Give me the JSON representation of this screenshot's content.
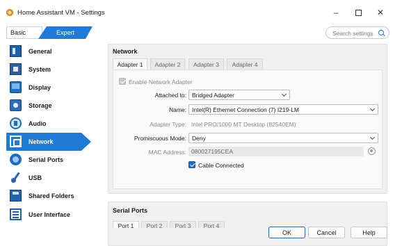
{
  "window": {
    "title": "Home Assistant VM - Settings",
    "minimize": "–",
    "close": "✕"
  },
  "mode": {
    "basic": "Basic",
    "expert": "Expert"
  },
  "search": {
    "placeholder": "Search settings"
  },
  "sidebar": {
    "items": [
      {
        "label": "General",
        "icon": "general-icon"
      },
      {
        "label": "System",
        "icon": "system-icon"
      },
      {
        "label": "Display",
        "icon": "display-icon"
      },
      {
        "label": "Storage",
        "icon": "storage-icon"
      },
      {
        "label": "Audio",
        "icon": "audio-icon"
      },
      {
        "label": "Network",
        "icon": "network-icon",
        "active": true
      },
      {
        "label": "Serial Ports",
        "icon": "serial-ports-icon"
      },
      {
        "label": "USB",
        "icon": "usb-icon"
      },
      {
        "label": "Shared Folders",
        "icon": "shared-folders-icon"
      },
      {
        "label": "User Interface",
        "icon": "user-interface-icon"
      }
    ]
  },
  "network": {
    "title": "Network",
    "tabs": [
      "Adapter 1",
      "Adapter 2",
      "Adapter 3",
      "Adapter 4"
    ],
    "active_tab": "Adapter 1",
    "enable_adapter": {
      "label": "Enable Network Adapter",
      "checked": true,
      "enabled": false
    },
    "attached_to": {
      "label": "Attached to:",
      "value": "Bridged Adapter"
    },
    "name": {
      "label": "Name:",
      "value": "Intel(R) Ethernet Connection (7) I219-LM"
    },
    "adapter_type": {
      "label": "Adapter Type:",
      "value": "Intel PRO/1000 MT Desktop (82540EM)"
    },
    "promiscuous_mode": {
      "label": "Promiscuous Mode:",
      "value": "Deny"
    },
    "mac_address": {
      "label": "MAC Address:",
      "value": "080027195CEA"
    },
    "cable_connected": {
      "label": "Cable Connected",
      "checked": true
    }
  },
  "serial_ports": {
    "title": "Serial Ports",
    "tabs": [
      "Port 1",
      "Port 2",
      "Port 3",
      "Port 4"
    ]
  },
  "buttons": {
    "ok": "OK",
    "cancel": "Cancel",
    "help": "Help"
  },
  "colors": {
    "accent": "#1e7bd8",
    "panel_bg": "#f0f0f0"
  }
}
